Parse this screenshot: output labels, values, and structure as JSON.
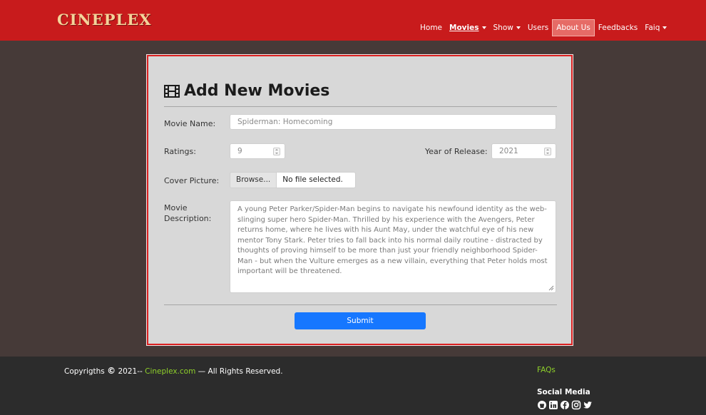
{
  "navbar": {
    "brand": "CINEPLEX",
    "items": [
      {
        "label": "Home"
      },
      {
        "label": "Movies",
        "active": true,
        "dropdown": true
      },
      {
        "label": "Show",
        "dropdown": true
      },
      {
        "label": "Users"
      },
      {
        "label": "About Us",
        "highlighted": true
      },
      {
        "label": "Feedbacks"
      },
      {
        "label": "Faiq",
        "dropdown": true
      }
    ],
    "color": "#c81b1c"
  },
  "form": {
    "title": "Add New Movies",
    "title_icon": "film-icon",
    "movie_name_label": "Movie Name:",
    "movie_name_placeholder": "Spiderman: Homecoming",
    "ratings_label": "Ratings:",
    "ratings_placeholder": "9",
    "year_label": "Year of Release:",
    "year_placeholder": "2021",
    "cover_label": "Cover Picture:",
    "browse_label": "Browse...",
    "file_status": "No file selected.",
    "description_label": "Movie Description:",
    "description_placeholder": "A young Peter Parker/Spider-Man begins to navigate his newfound identity as the web-slinging super hero Spider-Man. Thrilled by his experience with the Avengers, Peter returns home, where he lives with his Aunt May, under the watchful eye of his new mentor Tony Stark. Peter tries to fall back into his normal daily routine - distracted by thoughts of proving himself to be more than just your friendly neighborhood Spider-Man - but when the Vulture emerges as a new villain, everything that Peter holds most important will be threatened.",
    "submit_label": "Submit",
    "submit_color": "#1677ff"
  },
  "footer": {
    "copyright_prefix": "Copyrigths",
    "copyright_symbol": "©",
    "copyright_year": "2021--",
    "site_link": "Cineplex.com",
    "rights": "— All Rights Reserved.",
    "faqs_link": "FAQs",
    "social_title": "Social Media",
    "social_icons": [
      "github-icon",
      "linkedin-icon",
      "facebook-icon",
      "instagram-icon",
      "twitter-icon"
    ],
    "link_color": "#8fd12a"
  }
}
